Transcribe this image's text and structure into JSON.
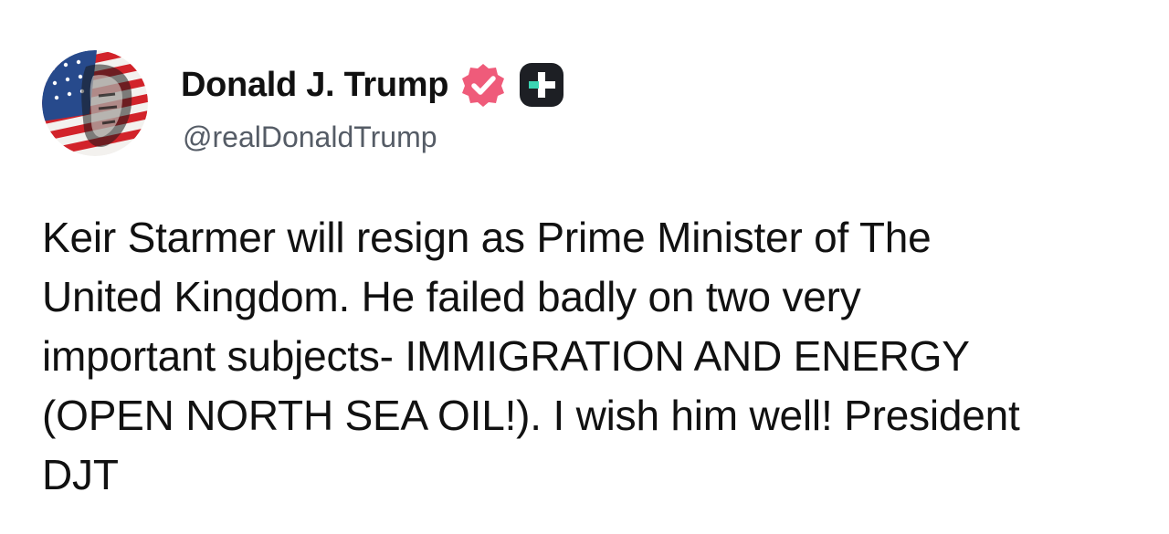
{
  "author": {
    "display_name": "Donald J. Trump",
    "handle": "@realDonaldTrump"
  },
  "icons": {
    "verified": "verified-badge-icon",
    "follow": "plus-icon",
    "avatar": "profile-avatar"
  },
  "colors": {
    "verified_badge": "#ef5b7a",
    "plus_button_bg": "#1d1f24",
    "plus_button_accent": "#3bd4b3"
  },
  "post": {
    "lines": [
      "Keir Starmer will resign as Prime Minister of The",
      "United Kingdom. He failed badly on two very",
      "important subjects- IMMIGRATION AND ENERGY",
      "(OPEN NORTH SEA OIL!). I wish him well! President",
      "DJT"
    ]
  }
}
